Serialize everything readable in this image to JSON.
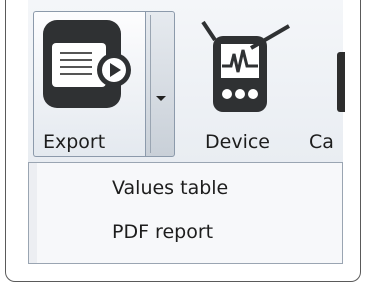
{
  "ribbon": {
    "export_label": "Export",
    "device_label": "Device",
    "partial_label": "Ca"
  },
  "export_menu": {
    "items": [
      {
        "label": "Values table"
      },
      {
        "label": "PDF report"
      }
    ]
  },
  "icons": {
    "export": "export-document-play-icon",
    "device": "device-graph-icon",
    "dropdown": "chevron-down-icon"
  }
}
